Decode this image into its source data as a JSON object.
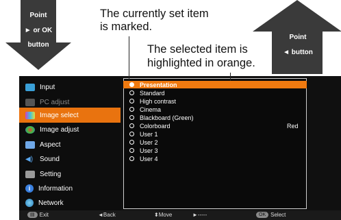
{
  "callouts": {
    "left_arrow": {
      "line1": "Point",
      "line2": "► or OK",
      "line3": "button"
    },
    "right_arrow": {
      "line1": "Point",
      "line2": "◄ button"
    },
    "top_caption": {
      "line1": "The currently set item",
      "line2": "is marked."
    },
    "right_caption": {
      "line1": "The selected item is",
      "line2": "highlighted in orange."
    }
  },
  "menu": {
    "items": [
      {
        "label": "Input",
        "icon": "input-icon",
        "color": "#3aa0d8"
      },
      {
        "label": "PC adjust",
        "icon": "pc-adjust-icon",
        "color": "#555555"
      },
      {
        "label": "Image select",
        "icon": "image-select-icon",
        "color": "#d040c0"
      },
      {
        "label": "Image adjust",
        "icon": "image-adjust-icon",
        "color": "#e04040"
      },
      {
        "label": "Aspect",
        "icon": "aspect-icon",
        "color": "#6fa8e8"
      },
      {
        "label": "Sound",
        "icon": "sound-icon",
        "color": "#5aa8f0"
      },
      {
        "label": "Setting",
        "icon": "setting-icon",
        "color": "#9a9a9a"
      },
      {
        "label": "Information",
        "icon": "information-icon",
        "color": "#3a80e0"
      },
      {
        "label": "Network",
        "icon": "network-icon",
        "color": "#3aa0d8"
      }
    ]
  },
  "options": [
    {
      "label": "Presentation",
      "value": ""
    },
    {
      "label": "Standard",
      "value": ""
    },
    {
      "label": "High contrast",
      "value": ""
    },
    {
      "label": "Cinema",
      "value": ""
    },
    {
      "label": "Blackboard (Green)",
      "value": ""
    },
    {
      "label": "Colorboard",
      "value": "Red"
    },
    {
      "label": "User 1",
      "value": ""
    },
    {
      "label": "User 2",
      "value": ""
    },
    {
      "label": "User 3",
      "value": ""
    },
    {
      "label": "User 4",
      "value": ""
    }
  ],
  "statusbar": {
    "exit_key": "▤",
    "exit": "Exit",
    "back": "◄Back",
    "move": "⬍Move",
    "next": "►-----",
    "select_key": "OK",
    "select": "Select"
  },
  "colors": {
    "highlight": "#f07a10",
    "active_menu": "#e9730f"
  }
}
